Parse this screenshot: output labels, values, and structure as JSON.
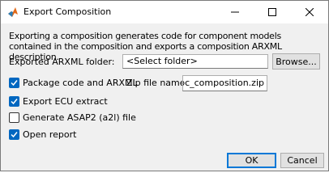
{
  "window": {
    "title": "Export Composition",
    "icon": "matlab-logo-icon"
  },
  "description": "Exporting a composition generates code for component models contained in the composition and exports a composition ARXML description.",
  "arxml_folder": {
    "label": "Exported ARXML folder:",
    "value": "<Select folder>",
    "browse_label": "Browse..."
  },
  "options": {
    "package": {
      "label": "Package code and ARXML",
      "checked": true
    },
    "zip": {
      "label": "Zip file name:",
      "value": "ar_tpc_composition.zip"
    },
    "ecu_extract": {
      "label": "Export ECU extract",
      "checked": true
    },
    "asap2": {
      "label": "Generate ASAP2 (a2l) file",
      "checked": false
    },
    "open_report": {
      "label": "Open report",
      "checked": true
    }
  },
  "buttons": {
    "ok": "OK",
    "cancel": "Cancel"
  },
  "colors": {
    "accent": "#0067c0",
    "default_border": "#0078d7"
  }
}
